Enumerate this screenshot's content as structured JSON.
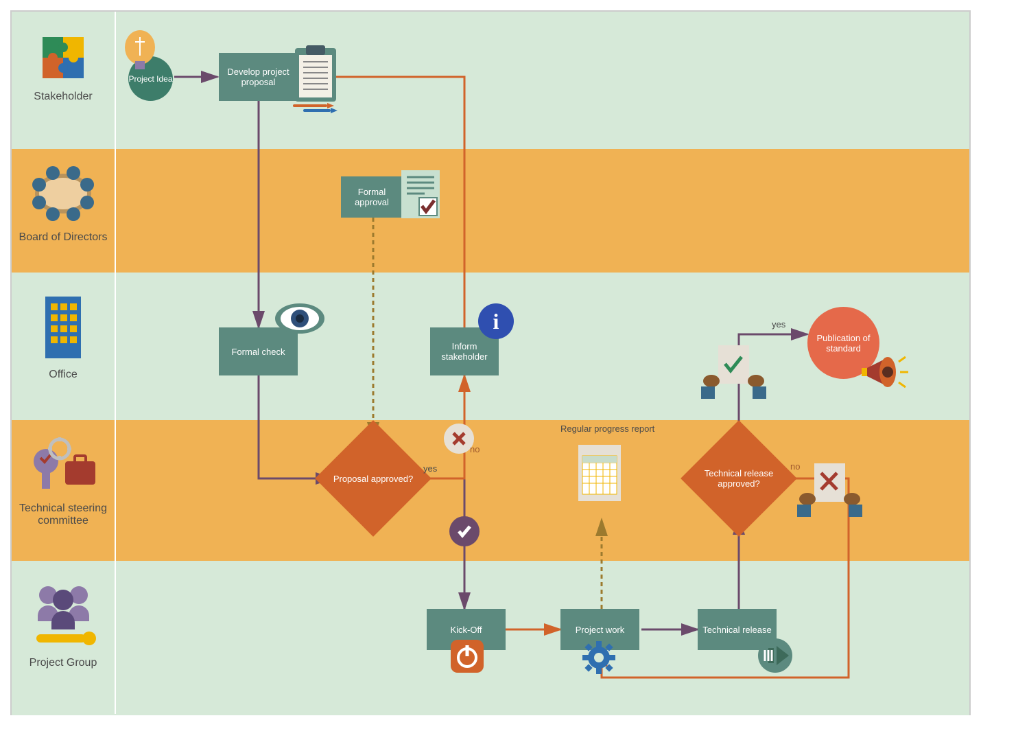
{
  "lanes": {
    "stakeholder": "Stakeholder",
    "board": "Board of Directors",
    "office": "Office",
    "tsc": "Technical steering committee",
    "pg": "Project Group"
  },
  "nodes": {
    "idea": "Project Idea",
    "develop": "Develop project proposal",
    "formalApproval": "Formal approval",
    "formalCheck": "Formal check",
    "informStakeholder": "Inform stakeholder",
    "proposalApproved": "Proposal approved?",
    "techReleaseApproved": "Technical release approved?",
    "kickoff": "Kick-Off",
    "projectWork": "Project work",
    "technicalRelease": "Technical release",
    "regularProgress": "Regular progress report",
    "publication": "Publication of standard"
  },
  "edges": {
    "yes": "yes",
    "no": "no"
  }
}
